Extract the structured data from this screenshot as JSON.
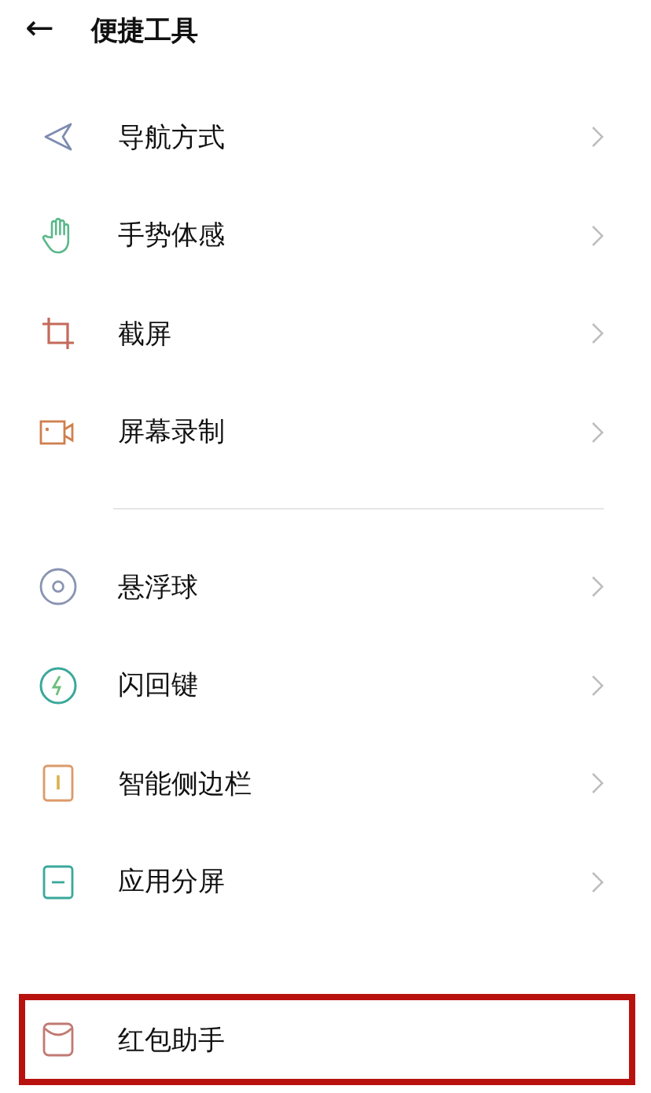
{
  "header": {
    "back_icon": "←",
    "title": "便捷工具"
  },
  "sections": [
    {
      "divider_after": true,
      "items": [
        {
          "kind": "navigation",
          "label": "导航方式",
          "chevron": true,
          "highlighted": false
        },
        {
          "kind": "gesture",
          "label": "手势体感",
          "chevron": true,
          "highlighted": false
        },
        {
          "kind": "screenshot",
          "label": "截屏",
          "chevron": true,
          "highlighted": false
        },
        {
          "kind": "record",
          "label": "屏幕录制",
          "chevron": true,
          "highlighted": false
        }
      ]
    },
    {
      "divider_after": false,
      "items": [
        {
          "kind": "ball",
          "label": "悬浮球",
          "chevron": true,
          "highlighted": false
        },
        {
          "kind": "flash",
          "label": "闪回键",
          "chevron": true,
          "highlighted": false
        },
        {
          "kind": "sidebar",
          "label": "智能侧边栏",
          "chevron": true,
          "highlighted": false
        },
        {
          "kind": "split",
          "label": "应用分屏",
          "chevron": true,
          "highlighted": false
        }
      ]
    },
    {
      "divider_after": false,
      "items": [
        {
          "kind": "envelope",
          "label": "红包助手",
          "chevron": false,
          "highlighted": true
        }
      ]
    }
  ]
}
